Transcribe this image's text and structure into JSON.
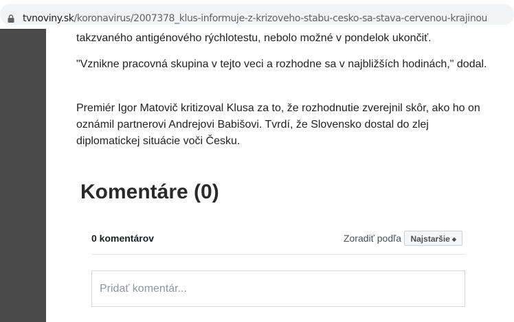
{
  "browser": {
    "url_host": "tvnoviny.sk",
    "url_path": "/koronavirus/2007378_klus-informuje-z-krizoveho-stabu-cesko-sa-stava-cervenou-krajinou"
  },
  "article": {
    "paragraphs": [
      "takzvaného antigénového rýchlotestu, nebolo možné v pondelok ukončiť.",
      "\"Vznikne pracovná skupina v tejto veci a rozhodne sa v najbližších hodinách,\" dodal.",
      "Premiér Igor Matovič kritizoval Klusa za to, že rozhodnutie zverejnil skôr, ako ho on oznámil partnerovi Andrejovi Babišovi. Tvrdí, že Slovensko dostal do zlej diplomatickej situácie voči Česku."
    ]
  },
  "comments": {
    "heading": "Komentáre (0)",
    "count_label": "0 komentárov",
    "sort_label": "Zoradiť podľa",
    "sort_selected": "Najstaršie",
    "sort_arrows": "◆",
    "input_placeholder": "Pridať komentár..."
  },
  "icons": {
    "lock": "lock-icon"
  }
}
